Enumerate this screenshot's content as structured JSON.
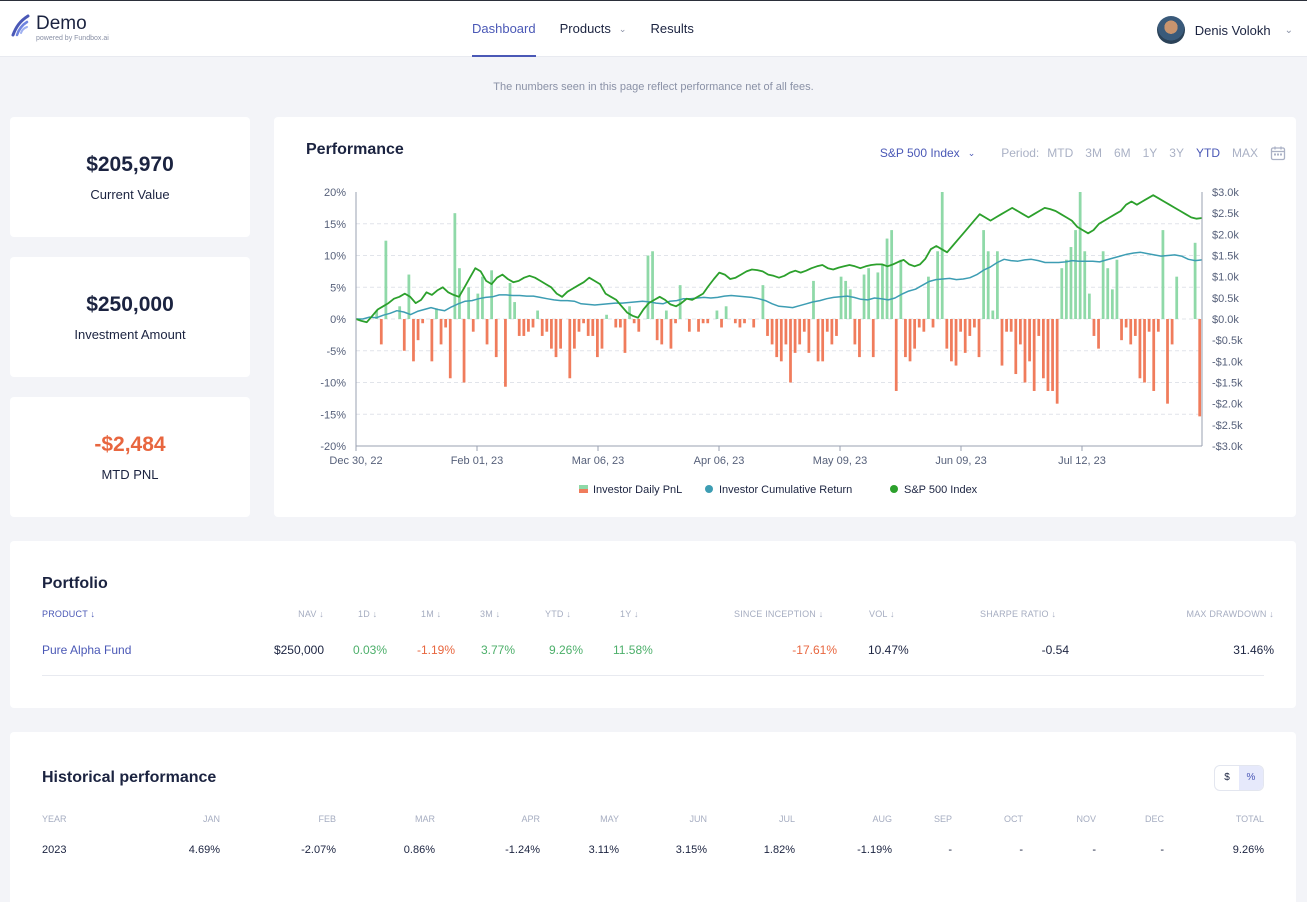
{
  "app": {
    "title": "Demo",
    "subtitle": "powered by Fundbox.ai"
  },
  "nav": {
    "items": [
      {
        "label": "Dashboard",
        "active": true
      },
      {
        "label": "Products",
        "has_dropdown": true
      },
      {
        "label": "Results"
      }
    ]
  },
  "user": {
    "name": "Denis Volokh"
  },
  "notice": "The numbers seen in this page reflect performance net of all fees.",
  "stats": [
    {
      "value": "$205,970",
      "label": "Current Value"
    },
    {
      "value": "$250,000",
      "label": "Investment Amount"
    },
    {
      "value": "-$2,484",
      "label": "MTD PNL"
    }
  ],
  "performance": {
    "title": "Performance",
    "index_select": "S&P 500 Index",
    "period_label": "Period:",
    "periods": [
      "MTD",
      "3M",
      "6M",
      "1Y",
      "3Y",
      "YTD",
      "MAX"
    ],
    "active_period": "YTD"
  },
  "chart_data": {
    "type": "bar",
    "x_tick_labels": [
      "Dec 30, 22",
      "Feb 01, 23",
      "Mar 06, 23",
      "Apr 06, 23",
      "May 09, 23",
      "Jun 09, 23",
      "Jul 12, 23"
    ],
    "y_left_ticks": [
      "20%",
      "15%",
      "10%",
      "5%",
      "0%",
      "-5%",
      "-10%",
      "-15%",
      "-20%"
    ],
    "y_right_ticks": [
      "$3.0k",
      "$2.5k",
      "$2.0k",
      "$1.5k",
      "$1.0k",
      "$0.5k",
      "$0.0k",
      "-$0.5k",
      "-$1.0k",
      "-$1.5k",
      "-$2.0k",
      "-$2.5k",
      "-$3.0k"
    ],
    "ylim_left": [
      -20,
      20
    ],
    "ylim_right": [
      -3000,
      3000
    ],
    "grid": true,
    "legend_placement": "bottom",
    "series": [
      {
        "name": "Investor Daily PnL",
        "axis": "right",
        "kind": "bar",
        "color_pos": "#8fd9a8",
        "color_neg": "#f07c5c",
        "values": [
          0,
          0,
          0,
          0,
          200,
          -600,
          1850,
          0,
          0,
          300,
          -750,
          1050,
          -1000,
          -500,
          -100,
          0,
          -1000,
          250,
          -600,
          -200,
          -1400,
          2500,
          1200,
          -1500,
          750,
          -300,
          600,
          1000,
          -600,
          1150,
          -900,
          0,
          -1600,
          850,
          400,
          -400,
          -400,
          -300,
          -200,
          200,
          -400,
          -300,
          -700,
          -900,
          -700,
          0,
          -1400,
          -700,
          -300,
          -100,
          -400,
          -400,
          -900,
          -700,
          100,
          0,
          -200,
          -200,
          -800,
          300,
          -100,
          -300,
          0,
          1500,
          1600,
          -500,
          -600,
          200,
          -700,
          -100,
          800,
          0,
          -300,
          0,
          -300,
          -100,
          -100,
          0,
          200,
          -200,
          300,
          0,
          -100,
          -200,
          -100,
          0,
          -200,
          0,
          800,
          -400,
          -600,
          -900,
          -1000,
          -600,
          -1500,
          -800,
          -600,
          -300,
          -800,
          900,
          -1000,
          -1000,
          -300,
          -600,
          -400,
          1000,
          900,
          700,
          -600,
          -900,
          1050,
          1200,
          -900,
          1100,
          1300,
          1900,
          2100,
          -1700,
          1400,
          -900,
          -1000,
          -700,
          -200,
          -300,
          1000,
          -200,
          1600,
          3000,
          -700,
          -1000,
          -1100,
          -300,
          -800,
          -400,
          -200,
          -900,
          2100,
          1600,
          200,
          1600,
          -1100,
          -300,
          -300,
          -1300,
          -600,
          -1500,
          -1000,
          -1700,
          -400,
          -1400,
          -1700,
          -1700,
          -2000,
          1200,
          1400,
          1700,
          2100,
          3000,
          1600,
          600,
          -400,
          -700,
          1600,
          1200,
          700,
          1400,
          -500,
          -200,
          -600,
          -400,
          -1400,
          -1500,
          -300,
          -1700,
          -300,
          2100,
          -2000,
          -600,
          1000,
          0,
          0,
          0,
          1800,
          -2300
        ]
      },
      {
        "name": "Investor Cumulative Return",
        "axis": "left",
        "kind": "line",
        "color": "#3d9db3",
        "values": [
          0,
          0,
          0.3,
          0.2,
          0.6,
          0.9,
          1.3,
          1.1,
          0.7,
          1.2,
          1.5,
          1.8,
          1.5,
          1.3,
          1.9,
          2.4,
          2.8,
          2.9,
          3.2,
          3.4,
          3.5,
          3.8,
          3.8,
          3.7,
          3.7,
          3.6,
          3.6,
          3.4,
          3.2,
          3.0,
          2.9,
          2.9,
          2.8,
          2.4,
          2.3,
          2.2,
          2.3,
          2.4,
          2.5,
          2.5,
          2.6,
          2.7,
          2.8,
          2.7,
          2.5,
          2.4,
          2.8,
          2.9,
          3.2,
          3.2,
          3.3,
          3.4,
          3.3,
          3.4,
          3.6,
          3.7,
          3.6,
          3.5,
          3.4,
          3.2,
          2.9,
          2.4,
          2.0,
          1.9,
          1.8,
          2.1,
          2.4,
          2.7,
          2.9,
          3.2,
          3.4,
          3.5,
          3.6,
          3.4,
          3.1,
          3.0,
          3.3,
          3.2,
          3.0,
          3.3,
          3.9,
          4.4,
          4.7,
          5.3,
          5.9,
          6.2,
          6.3,
          6.4,
          6.2,
          6.3,
          6.5,
          7.0,
          7.7,
          8.2,
          8.9,
          9.4,
          9.2,
          9.1,
          9.3,
          9.4,
          9.2,
          8.9,
          8.9,
          8.9,
          9.0,
          9.2,
          9.1,
          9.1,
          9.1,
          9.0,
          9.3,
          9.6,
          9.9,
          10.2,
          10.4,
          10.5,
          10.3,
          10.1,
          9.9,
          10.0,
          10.1,
          9.9,
          9.4,
          9.2,
          9.3
        ]
      },
      {
        "name": "S&P 500 Index",
        "axis": "left",
        "kind": "line",
        "color": "#2ca02c",
        "values": [
          0,
          -0.3,
          -0.5,
          0.5,
          1.5,
          2.0,
          2.5,
          3.2,
          3.5,
          4.0,
          3.5,
          2.5,
          3.0,
          4.2,
          3.8,
          4.5,
          5.0,
          4.2,
          3.8,
          3.5,
          5.0,
          6.5,
          8.0,
          7.5,
          6.0,
          5.5,
          6.5,
          7.0,
          6.3,
          5.8,
          6.0,
          6.5,
          6.8,
          6.5,
          6.0,
          5.5,
          5.0,
          4.0,
          3.5,
          4.3,
          4.8,
          5.3,
          5.8,
          6.5,
          6.0,
          5.5,
          4.0,
          3.5,
          3.0,
          2.0,
          1.0,
          0.5,
          0.2,
          1.5,
          2.5,
          3.0,
          3.5,
          3.0,
          2.3,
          2.0,
          2.5,
          3.2,
          3.0,
          3.5,
          4.0,
          5.2,
          6.3,
          7.3,
          7.0,
          6.3,
          6.5,
          7.0,
          7.5,
          7.8,
          7.7,
          7.5,
          7.0,
          6.8,
          6.5,
          6.8,
          7.3,
          7.6,
          7.3,
          7.6,
          8.0,
          8.3,
          8.5,
          8.0,
          7.8,
          8.1,
          8.3,
          8.5,
          8.3,
          8.0,
          8.3,
          8.5,
          8.6,
          8.6,
          8.3,
          8.6,
          9.0,
          9.3,
          8.6,
          8.3,
          8.6,
          9.5,
          11.0,
          11.5,
          11.0,
          10.5,
          11.5,
          12.5,
          13.5,
          14.5,
          15.5,
          16.5,
          16.0,
          15.5,
          16.0,
          16.5,
          17.0,
          17.5,
          17.0,
          16.5,
          16.0,
          16.5,
          17.0,
          17.5,
          17.3,
          17.0,
          16.5,
          16.0,
          15.5,
          14.5,
          14.0,
          13.5,
          14.0,
          15.0,
          15.5,
          16.0,
          16.5,
          17.0,
          18.0,
          18.5,
          18.0,
          18.5,
          19.0,
          19.5,
          19.0,
          18.5,
          18.0,
          17.5,
          17.0,
          16.5,
          16.0,
          15.8,
          15.9
        ]
      }
    ]
  },
  "portfolio": {
    "title": "Portfolio",
    "columns": [
      "PRODUCT",
      "NAV",
      "1D",
      "1M",
      "3M",
      "YTD",
      "1Y",
      "SINCE INCEPTION",
      "VOL",
      "SHARPE RATIO",
      "MAX DRAWDOWN"
    ],
    "rows": [
      {
        "product": "Pure Alpha Fund",
        "nav": "$250,000",
        "d1": "0.03%",
        "m1": "-1.19%",
        "m3": "3.77%",
        "ytd": "9.26%",
        "y1": "11.58%",
        "since_inception": "-17.61%",
        "vol": "10.47%",
        "sharpe": "-0.54",
        "max_drawdown": "31.46%"
      }
    ]
  },
  "historical": {
    "title": "Historical performance",
    "toggle": [
      "$",
      "%"
    ],
    "active_toggle": "%",
    "columns": [
      "YEAR",
      "JAN",
      "FEB",
      "MAR",
      "APR",
      "MAY",
      "JUN",
      "JUL",
      "AUG",
      "SEP",
      "OCT",
      "NOV",
      "DEC",
      "TOTAL"
    ],
    "rows": [
      {
        "year": "2023",
        "jan": "4.69%",
        "feb": "-2.07%",
        "mar": "0.86%",
        "apr": "-1.24%",
        "may": "3.11%",
        "jun": "3.15%",
        "jul": "1.82%",
        "aug": "-1.19%",
        "sep": "-",
        "oct": "-",
        "nov": "-",
        "dec": "-",
        "total": "9.26%"
      }
    ]
  },
  "colors": {
    "accent": "#4a58b6",
    "positive": "#4caf6a",
    "negative": "#e8663f"
  }
}
